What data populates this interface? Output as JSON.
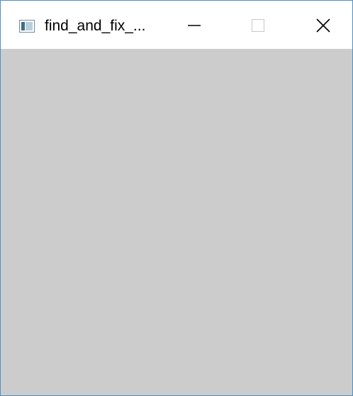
{
  "window": {
    "title": "find_and_fix_...",
    "client_background": "#cccccc",
    "border_color": "#4a90c8"
  },
  "icons": {
    "app": "app-window-icon",
    "minimize": "minimize-icon",
    "maximize": "maximize-icon",
    "close": "close-icon"
  }
}
